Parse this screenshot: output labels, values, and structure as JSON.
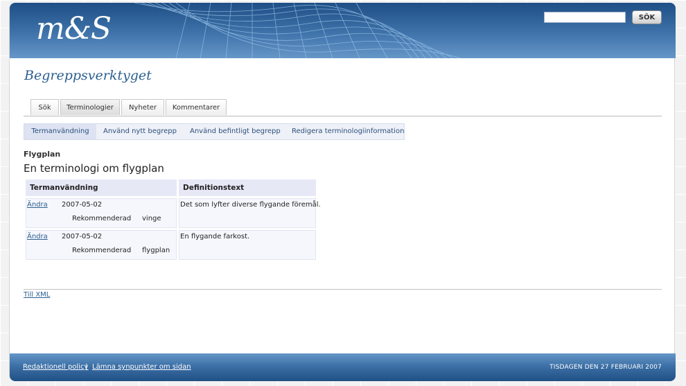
{
  "header": {
    "logo": "m&S",
    "search": {
      "value": "",
      "button_label": "SÖK"
    }
  },
  "site_title": "Begreppsverktyget",
  "tabs": [
    {
      "label": "Sök"
    },
    {
      "label": "Terminologier",
      "active": true
    },
    {
      "label": "Nyheter"
    },
    {
      "label": "Kommentarer"
    }
  ],
  "subtabs": [
    {
      "label": "Termanvändning",
      "active": true
    },
    {
      "label": "Använd nytt begrepp"
    },
    {
      "label": "Använd befintligt begrepp"
    },
    {
      "label": "Redigera terminologiinformation"
    }
  ],
  "section": {
    "label": "Flygplan",
    "heading": "En terminologi om flygplan"
  },
  "table": {
    "headers": [
      "Termanvändning",
      "Definitionstext"
    ],
    "rows": [
      {
        "edit": "Ändra",
        "date": "2007-05-02",
        "status": "Rekommenderad",
        "term": "vinge",
        "definition": "Det som lyfter diverse flygande föremål."
      },
      {
        "edit": "Ändra",
        "date": "2007-05-02",
        "status": "Rekommenderad",
        "term": "flygplan",
        "definition": "En flygande farkost."
      }
    ]
  },
  "xml_link": "Till XML",
  "footer": {
    "links": [
      "Redaktionell policy",
      "Lämna synpunkter om sidan"
    ],
    "separator": "|",
    "date": "TISDAGEN DEN 27 FEBRUARI 2007"
  },
  "colors": {
    "header_blue": "#1e4f86",
    "link_blue": "#2b5f8f",
    "table_header": "#e6e8f6"
  }
}
